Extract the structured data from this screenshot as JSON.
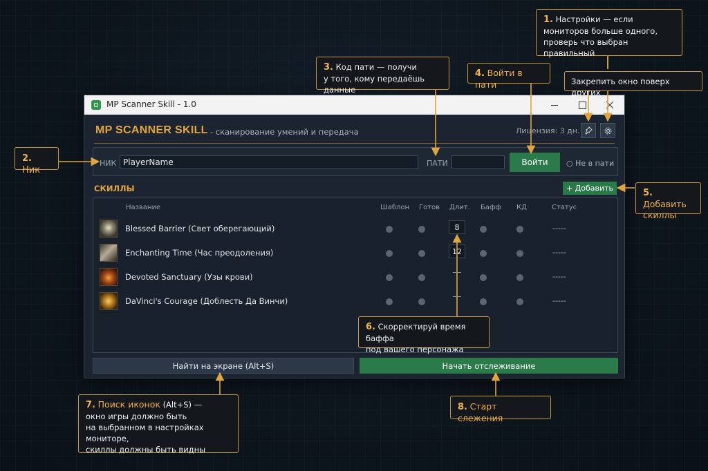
{
  "window": {
    "title": "MP Scanner Skill - 1.0"
  },
  "header": {
    "title": "MP SCANNER SKILL",
    "subtitle": "-  сканирование умений и передача",
    "license": "Лицензия: 3 дн."
  },
  "nick": {
    "label": "НИК",
    "value": "PlayerName"
  },
  "party": {
    "label": "ПАТИ",
    "value": "",
    "login_button": "Войти",
    "status": "○ Не в пати"
  },
  "skills": {
    "title": "СКИЛЛЫ",
    "add_button": "+ Добавить",
    "columns": {
      "name": "Название",
      "template": "Шаблон",
      "ready": "Готов",
      "duration": "Длит.",
      "buff": "Бафф",
      "cd": "КД",
      "status": "Статус"
    },
    "rows": [
      {
        "name": "Blessed Barrier (Свет оберегающий)",
        "duration": "8",
        "status": "-----"
      },
      {
        "name": "Enchanting Time (Час преодоления)",
        "duration": "12",
        "status": "-----"
      },
      {
        "name": "Devoted Sanctuary (Узы крови)",
        "duration": "—",
        "status": "-----"
      },
      {
        "name": "DaVinci's Courage (Доблесть Да Винчи)",
        "duration": "—",
        "status": "-----"
      }
    ]
  },
  "buttons": {
    "find": "Найти на экране (Alt+S)",
    "start": "Начать отслеживание"
  },
  "callouts": {
    "c1": {
      "num": "1.",
      "line1": "Настройки — если",
      "line2": "мониторов больше одного,",
      "line3": "проверь что выбран правильный"
    },
    "pin": {
      "text": "Закрепить окно поверх других"
    },
    "c2": {
      "num": "2.",
      "text": "Ник"
    },
    "c3": {
      "num": "3.",
      "line1": "Код пати — получи",
      "line2": "у того, кому передаёшь данные"
    },
    "c4": {
      "num": "4.",
      "text": "Войти в пати"
    },
    "c5": {
      "num": "5.",
      "line1": "Добавить",
      "line2": "скиллы"
    },
    "c6": {
      "num": "6.",
      "line1": "Скорректируй время баффа",
      "line2": "под вашего персонажа"
    },
    "c7": {
      "num": "7.",
      "line1": "Поиск иконок",
      "line1b": "(Alt+S) —",
      "line2": "окно игры должно быть",
      "line3": "на выбранном в настройках мониторе,",
      "line4": "скиллы должны быть видны"
    },
    "c8": {
      "num": "8.",
      "text": "Старт слежения"
    }
  },
  "colors": {
    "accent": "#e1a540",
    "green": "#2a7a4a",
    "background": "#0d151d",
    "window": "#1b2430"
  }
}
